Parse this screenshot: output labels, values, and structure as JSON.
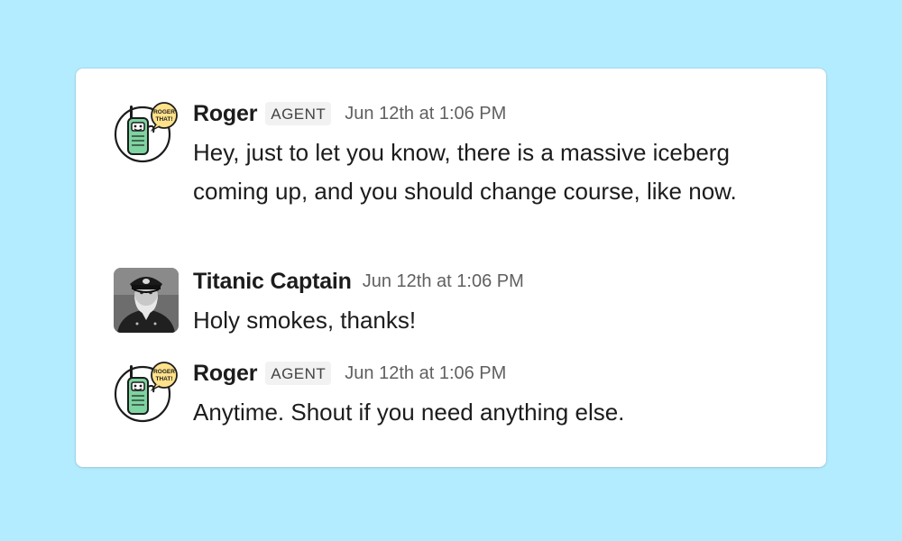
{
  "colors": {
    "page_background": "#b3ecff",
    "card_background": "#ffffff",
    "text_primary": "#1d1c1d",
    "text_secondary": "#616061",
    "badge_background": "#f2f2f2",
    "walkie_green": "#7ed4a0"
  },
  "messages": [
    {
      "avatar": "walkie-talkie-mascot-icon",
      "avatar_badge_text": "ROGER THAT!",
      "sender": "Roger",
      "badge": "AGENT",
      "timestamp": "Jun 12th at 1:06 PM",
      "text": "Hey, just to let you know, there is a massive iceberg coming up, and you should change course, like now."
    },
    {
      "avatar": "captain-photo-avatar",
      "sender": "Titanic Captain",
      "timestamp": "Jun 12th at 1:06 PM",
      "text": "Holy smokes, thanks!"
    },
    {
      "avatar": "walkie-talkie-mascot-icon",
      "avatar_badge_text": "ROGER THAT!",
      "sender": "Roger",
      "badge": "AGENT",
      "timestamp": "Jun 12th at 1:06 PM",
      "text": "Anytime. Shout if you need anything else."
    }
  ]
}
